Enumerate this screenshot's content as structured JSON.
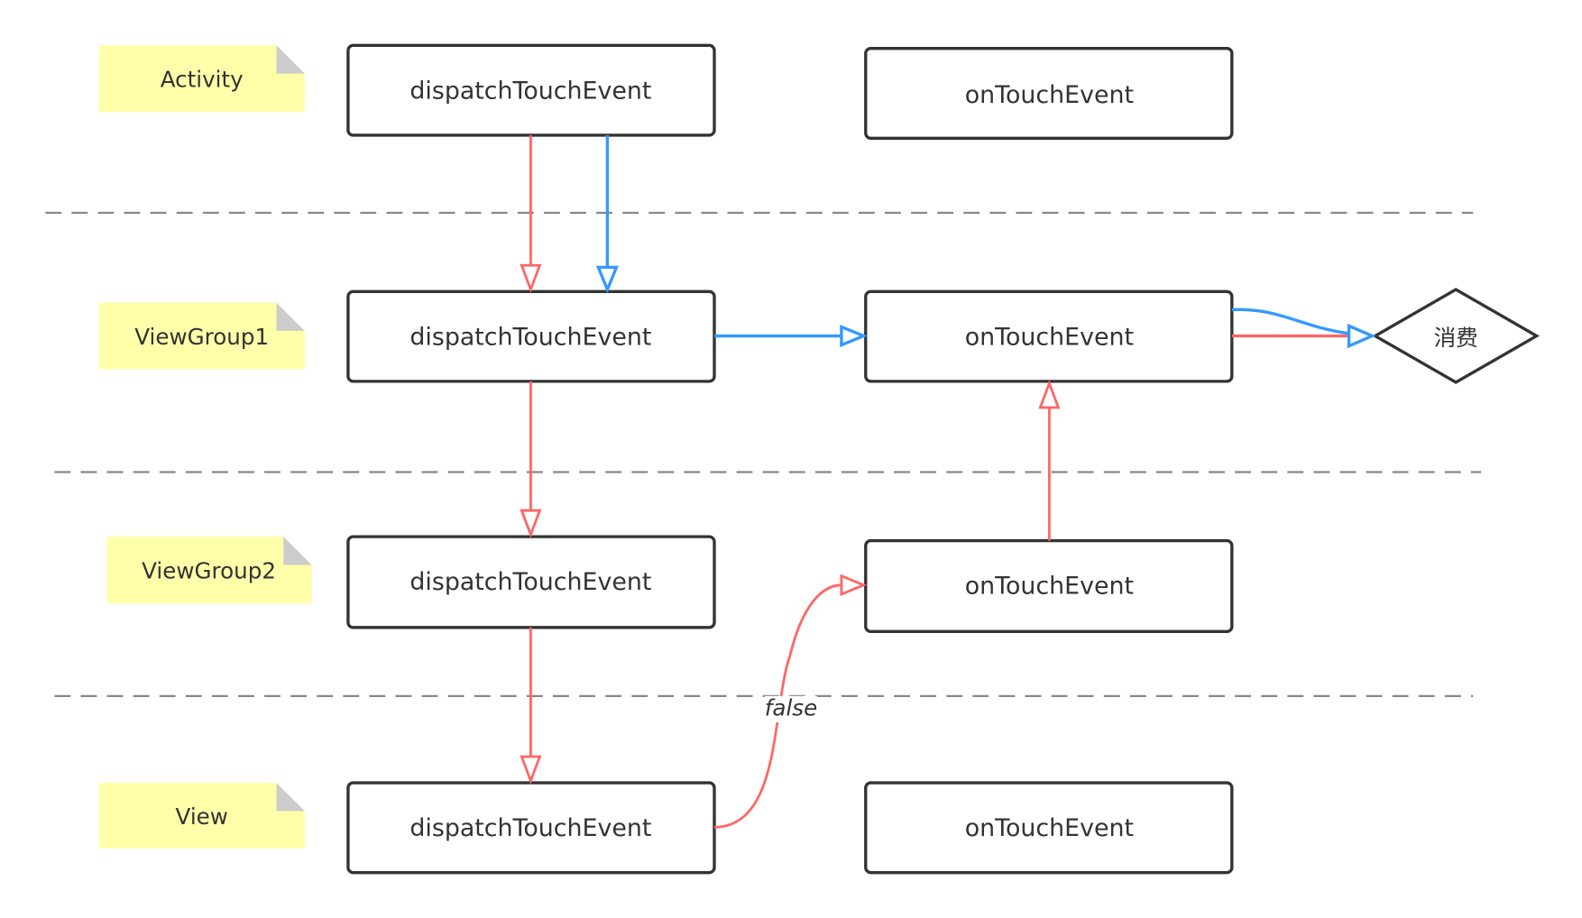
{
  "colors": {
    "note_bg": "#ffffaa",
    "note_fold": "#cccccc",
    "red_arrow": "#ff6666",
    "blue_arrow": "#3399ff",
    "box_border": "#333333"
  },
  "layers": [
    {
      "label": "Activity",
      "dispatch": "dispatchTouchEvent",
      "on_touch": "onTouchEvent"
    },
    {
      "label": "ViewGroup1",
      "dispatch": "dispatchTouchEvent",
      "on_touch": "onTouchEvent"
    },
    {
      "label": "ViewGroup2",
      "dispatch": "dispatchTouchEvent",
      "on_touch": "onTouchEvent"
    },
    {
      "label": "View",
      "dispatch": "dispatchTouchEvent",
      "on_touch": "onTouchEvent"
    }
  ],
  "consume_label": "消费",
  "edge_false_label": "false"
}
